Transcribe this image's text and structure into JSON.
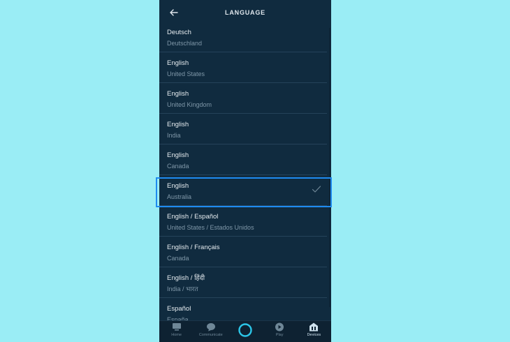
{
  "header": {
    "title": "LANGUAGE"
  },
  "languages": [
    {
      "language": "Deutsch",
      "region": "Deutschland"
    },
    {
      "language": "English",
      "region": "United States"
    },
    {
      "language": "English",
      "region": "United Kingdom"
    },
    {
      "language": "English",
      "region": "India"
    },
    {
      "language": "English",
      "region": "Canada"
    },
    {
      "language": "English",
      "region": "Australia",
      "selected": true
    },
    {
      "language": "English / Español",
      "region": "United States / Estados Unidos"
    },
    {
      "language": "English / Français",
      "region": "Canada"
    },
    {
      "language": "English / हिंदी",
      "region": "India / भारत"
    },
    {
      "language": "Español",
      "region": "España"
    }
  ],
  "tabs": [
    {
      "label": "Home",
      "icon": "home-icon"
    },
    {
      "label": "Communicate",
      "icon": "chat-icon"
    },
    {
      "label": "",
      "icon": "alexa-icon"
    },
    {
      "label": "Play",
      "icon": "play-icon"
    },
    {
      "label": "Devices",
      "icon": "devices-icon",
      "active": true
    }
  ],
  "colors": {
    "background": "#102b3f",
    "accent": "#1e8bf0",
    "outer": "#9aedf5"
  }
}
